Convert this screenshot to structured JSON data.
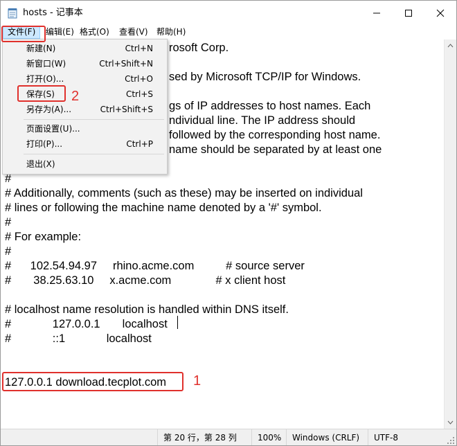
{
  "window": {
    "title": "hosts - 记事本"
  },
  "menubar": {
    "items": [
      {
        "label": "文件(F)"
      },
      {
        "label": "编辑(E)"
      },
      {
        "label": "格式(O)"
      },
      {
        "label": "查看(V)"
      },
      {
        "label": "帮助(H)"
      }
    ]
  },
  "file_menu": {
    "items": [
      {
        "label": "新建(N)",
        "shortcut": "Ctrl+N"
      },
      {
        "label": "新窗口(W)",
        "shortcut": "Ctrl+Shift+N"
      },
      {
        "label": "打开(O)...",
        "shortcut": "Ctrl+O"
      },
      {
        "label": "保存(S)",
        "shortcut": "Ctrl+S"
      },
      {
        "label": "另存为(A)...",
        "shortcut": "Ctrl+Shift+S"
      },
      {
        "label": "页面设置(U)...",
        "shortcut": ""
      },
      {
        "label": "打印(P)...",
        "shortcut": "Ctrl+P"
      },
      {
        "label": "退出(X)",
        "shortcut": ""
      }
    ]
  },
  "editor": {
    "lines": [
      "rosoft Corp.",
      "sed by Microsoft TCP/IP for Windows.",
      "gs of IP addresses to host names. Each",
      "ndividual line. The IP address should",
      "followed by the corresponding host name.",
      "name should be separated by at least one",
      "#",
      "# Additionally, comments (such as these) may be inserted on individual",
      "# lines or following the machine name denoted by a '#' symbol.",
      "#",
      "# For example:",
      "#",
      "#      102.54.94.97     rhino.acme.com          # source server",
      "#       38.25.63.10     x.acme.com              # x client host",
      "# localhost name resolution is handled within DNS itself.",
      "#             127.0.0.1       localhost",
      "#             ::1             localhost",
      "127.0.0.1 download.tecplot.com"
    ]
  },
  "statusbar": {
    "position": "第 20 行，第 28 列",
    "zoom": "100%",
    "line_ending": "Windows (CRLF)",
    "encoding": "UTF-8"
  },
  "annotations": {
    "label_1": "1",
    "label_2": "2"
  },
  "colors": {
    "annotation_red": "#e0302c",
    "menu_highlight": "#cce8ff"
  }
}
